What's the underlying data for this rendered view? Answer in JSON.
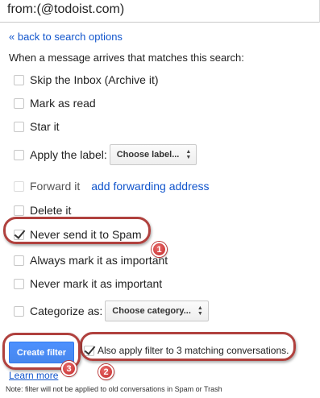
{
  "search": {
    "query": "from:(@todoist.com)"
  },
  "back_link": "« back to search options",
  "intro": "When a message arrives that matches this search:",
  "options": [
    {
      "label": "Skip the Inbox (Archive it)",
      "checked": false
    },
    {
      "label": "Mark as read",
      "checked": false
    },
    {
      "label": "Star it",
      "checked": false
    },
    {
      "label": "Apply the label:",
      "checked": false,
      "dropdown": "Choose label..."
    },
    {
      "label": "Forward it",
      "checked": false,
      "link": "add forwarding address"
    },
    {
      "label": "Delete it",
      "checked": false
    },
    {
      "label": "Never send it to Spam",
      "checked": true
    },
    {
      "label": "Always mark it as important",
      "checked": false
    },
    {
      "label": "Never mark it as important",
      "checked": false
    },
    {
      "label": "Categorize as:",
      "checked": false,
      "dropdown": "Choose category..."
    }
  ],
  "create_button": "Create filter",
  "apply_option": {
    "label": "Also apply filter to 3 matching conversations.",
    "checked": true
  },
  "learn_more": "Learn more",
  "note": "Note: filter will not be applied to old conversations in Spam or Trash",
  "badges": [
    "1",
    "2",
    "3"
  ],
  "colors": {
    "link": "#1155cc",
    "button": "#4d90fe",
    "callout": "#b0413e",
    "badge": "#c42b2b"
  }
}
